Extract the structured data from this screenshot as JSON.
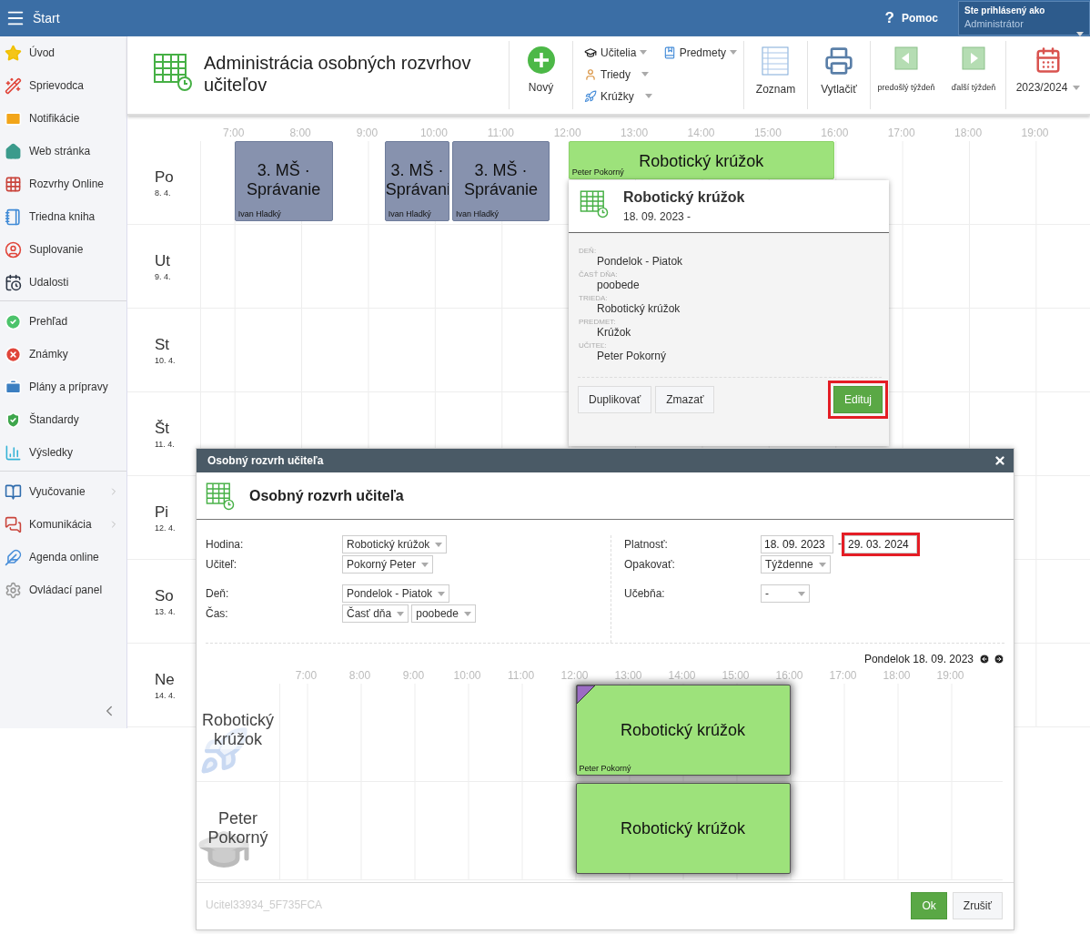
{
  "topbar": {
    "title": "Štart",
    "help_mark": "?",
    "help": "Pomoc",
    "user_caption": "Ste prihlásený ako",
    "user_name": "Administrátor"
  },
  "sidebar": {
    "groups": [
      [
        {
          "label": "Úvod",
          "has_submenu": false
        },
        {
          "label": "Sprievodca",
          "has_submenu": false
        },
        {
          "label": "Notifikácie",
          "has_submenu": false
        },
        {
          "label": "Web stránka",
          "has_submenu": false
        },
        {
          "label": "Rozvrhy Online",
          "has_submenu": false
        },
        {
          "label": "Triedna kniha",
          "has_submenu": false
        },
        {
          "label": "Suplovanie",
          "has_submenu": false
        },
        {
          "label": "Udalosti",
          "has_submenu": false
        }
      ],
      [
        {
          "label": "Prehľad",
          "has_submenu": false
        },
        {
          "label": "Známky",
          "has_submenu": false
        },
        {
          "label": "Plány a prípravy",
          "has_submenu": false
        },
        {
          "label": "Štandardy",
          "has_submenu": false
        },
        {
          "label": "Výsledky",
          "has_submenu": false
        }
      ],
      [
        {
          "label": "Vyučovanie",
          "has_submenu": true
        },
        {
          "label": "Komunikácia",
          "has_submenu": true
        },
        {
          "label": "Agenda online",
          "has_submenu": false
        },
        {
          "label": "Ovládací panel",
          "has_submenu": false
        }
      ]
    ]
  },
  "toolbar": {
    "title": "Administrácia osobných rozvrhov učiteľov",
    "new": "Nový",
    "filter_columns": [
      [
        {
          "label": "Učitelia"
        },
        {
          "label": "Triedy"
        },
        {
          "label": "Krúžky"
        }
      ],
      [
        {
          "label": "Predmety"
        }
      ]
    ],
    "list": "Zoznam",
    "print": "Vytlačiť",
    "prev_week": "predošlý týždeň",
    "next_week": "ďalší týždeň",
    "year": "2023/2024"
  },
  "schedule": {
    "hours": [
      "7:00",
      "8:00",
      "9:00",
      "10:00",
      "11:00",
      "12:00",
      "13:00",
      "14:00",
      "15:00",
      "16:00",
      "17:00",
      "18:00",
      "19:00"
    ],
    "days": [
      {
        "name": "Po",
        "date": "8. 4.",
        "events": [
          {
            "kind": "lesson",
            "title": "3. MŠ · Správanie",
            "teacher": "Ivan Hladký",
            "color": "#8792ae"
          },
          {
            "kind": "lesson",
            "title": "3. MŠ · Správani",
            "teacher": "Ivan Hladký",
            "color": "#8792ae"
          },
          {
            "kind": "lesson",
            "title": "3. MŠ · Správanie",
            "teacher": "Ivan Hladký",
            "color": "#8792ae"
          },
          {
            "kind": "club",
            "title": "Robotický krúžok",
            "teacher": "Peter Pokorný",
            "color": "#9de27b"
          }
        ]
      },
      {
        "name": "Ut",
        "date": "9. 4."
      },
      {
        "name": "St",
        "date": "10. 4."
      },
      {
        "name": "Št",
        "date": "11. 4."
      },
      {
        "name": "Pi",
        "date": "12. 4."
      },
      {
        "name": "So",
        "date": "13. 4."
      },
      {
        "name": "Ne",
        "date": "14. 4."
      }
    ]
  },
  "popup": {
    "title": "Robotický krúžok",
    "date": "18. 09. 2023 -",
    "fields": [
      {
        "label": "DEŇ:",
        "value": "Pondelok - Piatok"
      },
      {
        "label": "ČASŤ DŇA:",
        "value": "poobede"
      },
      {
        "label": "TRIEDA:",
        "value": "Robotický krúžok"
      },
      {
        "label": "PREDMET:",
        "value": "Krúžok"
      },
      {
        "label": "UČITEĽ:",
        "value": "Peter Pokorný"
      }
    ],
    "buttons": [
      {
        "label": "Duplikovať",
        "kind": "default",
        "highlighted": false
      },
      {
        "label": "Zmazať",
        "kind": "default",
        "highlighted": false
      },
      {
        "label": "Edituj",
        "kind": "primary",
        "highlighted": true
      }
    ]
  },
  "dialog": {
    "window_title": "Osobný rozvrh učiteľa",
    "heading": "Osobný rozvrh učiteľa",
    "left_groups": [
      [
        {
          "label": "Hodina:",
          "controls": [
            {
              "kind": "select",
              "value": "Robotický krúžok"
            }
          ]
        },
        {
          "label": "Učiteľ:",
          "controls": [
            {
              "kind": "select",
              "value": "Pokorný Peter"
            }
          ]
        }
      ],
      [
        {
          "label": "Deň:",
          "controls": [
            {
              "kind": "select",
              "value": "Pondelok - Piatok"
            }
          ]
        },
        {
          "label": "Čas:",
          "controls": [
            {
              "kind": "select",
              "value": "Časť dňa"
            },
            {
              "kind": "select",
              "value": "poobede"
            }
          ]
        }
      ]
    ],
    "right_groups": [
      [
        {
          "label": "Platnosť:",
          "controls": [
            {
              "kind": "date",
              "value": "18. 09. 2023",
              "highlighted": false
            },
            {
              "kind": "separator",
              "value": "-"
            },
            {
              "kind": "date",
              "value": "29. 03. 2024",
              "highlighted": true
            }
          ]
        },
        {
          "label": "Opakovať:",
          "controls": [
            {
              "kind": "select",
              "value": "Týždenne"
            }
          ]
        }
      ],
      [
        {
          "label": "Učebňa:",
          "controls": [
            {
              "kind": "select",
              "value": "-"
            }
          ]
        }
      ]
    ],
    "day_label": "Pondelok 18. 09. 2023",
    "hours": [
      "7:00",
      "8:00",
      "9:00",
      "10:00",
      "11:00",
      "12:00",
      "13:00",
      "14:00",
      "15:00",
      "16:00",
      "17:00",
      "18:00",
      "19:00"
    ],
    "rows": [
      {
        "label": "Robotický krúžok",
        "events": [
          {
            "title": "Robotický krúžok",
            "teacher": "Peter Pokorný",
            "flagged": true
          }
        ]
      },
      {
        "label": "Peter Pokorný",
        "events": [
          {
            "title": "Robotický krúžok",
            "flagged": false
          }
        ]
      }
    ],
    "code": "Ucitel33934_5F735FCA",
    "buttons": [
      {
        "label": "Ok",
        "kind": "primary"
      },
      {
        "label": "Zrušiť",
        "kind": "default"
      }
    ]
  }
}
